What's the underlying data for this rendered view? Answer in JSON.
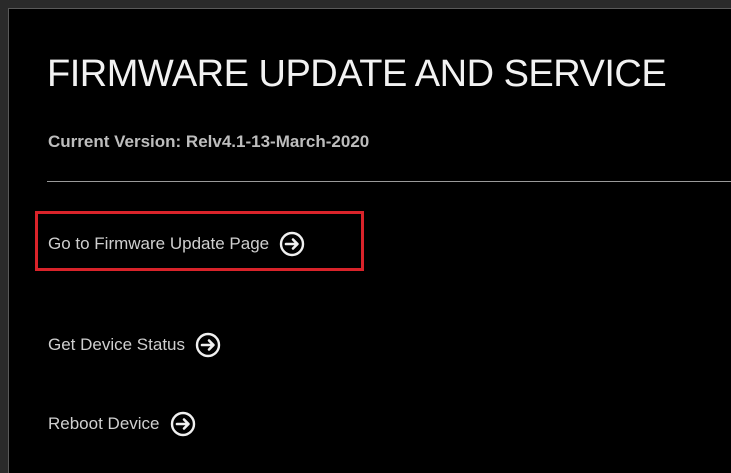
{
  "header": {
    "title": "FIRMWARE UPDATE AND SERVICE",
    "version_text": "Current Version: Relv4.1-13-March-2020"
  },
  "links": {
    "firmware_update": "Go to Firmware Update Page",
    "device_status": "Get Device Status",
    "reboot": "Reboot Device"
  },
  "icons": {
    "arrow": "arrow-right-circle-icon"
  },
  "colors": {
    "background": "#000000",
    "highlight": "#d9232a",
    "text": "#d7d7d7"
  }
}
